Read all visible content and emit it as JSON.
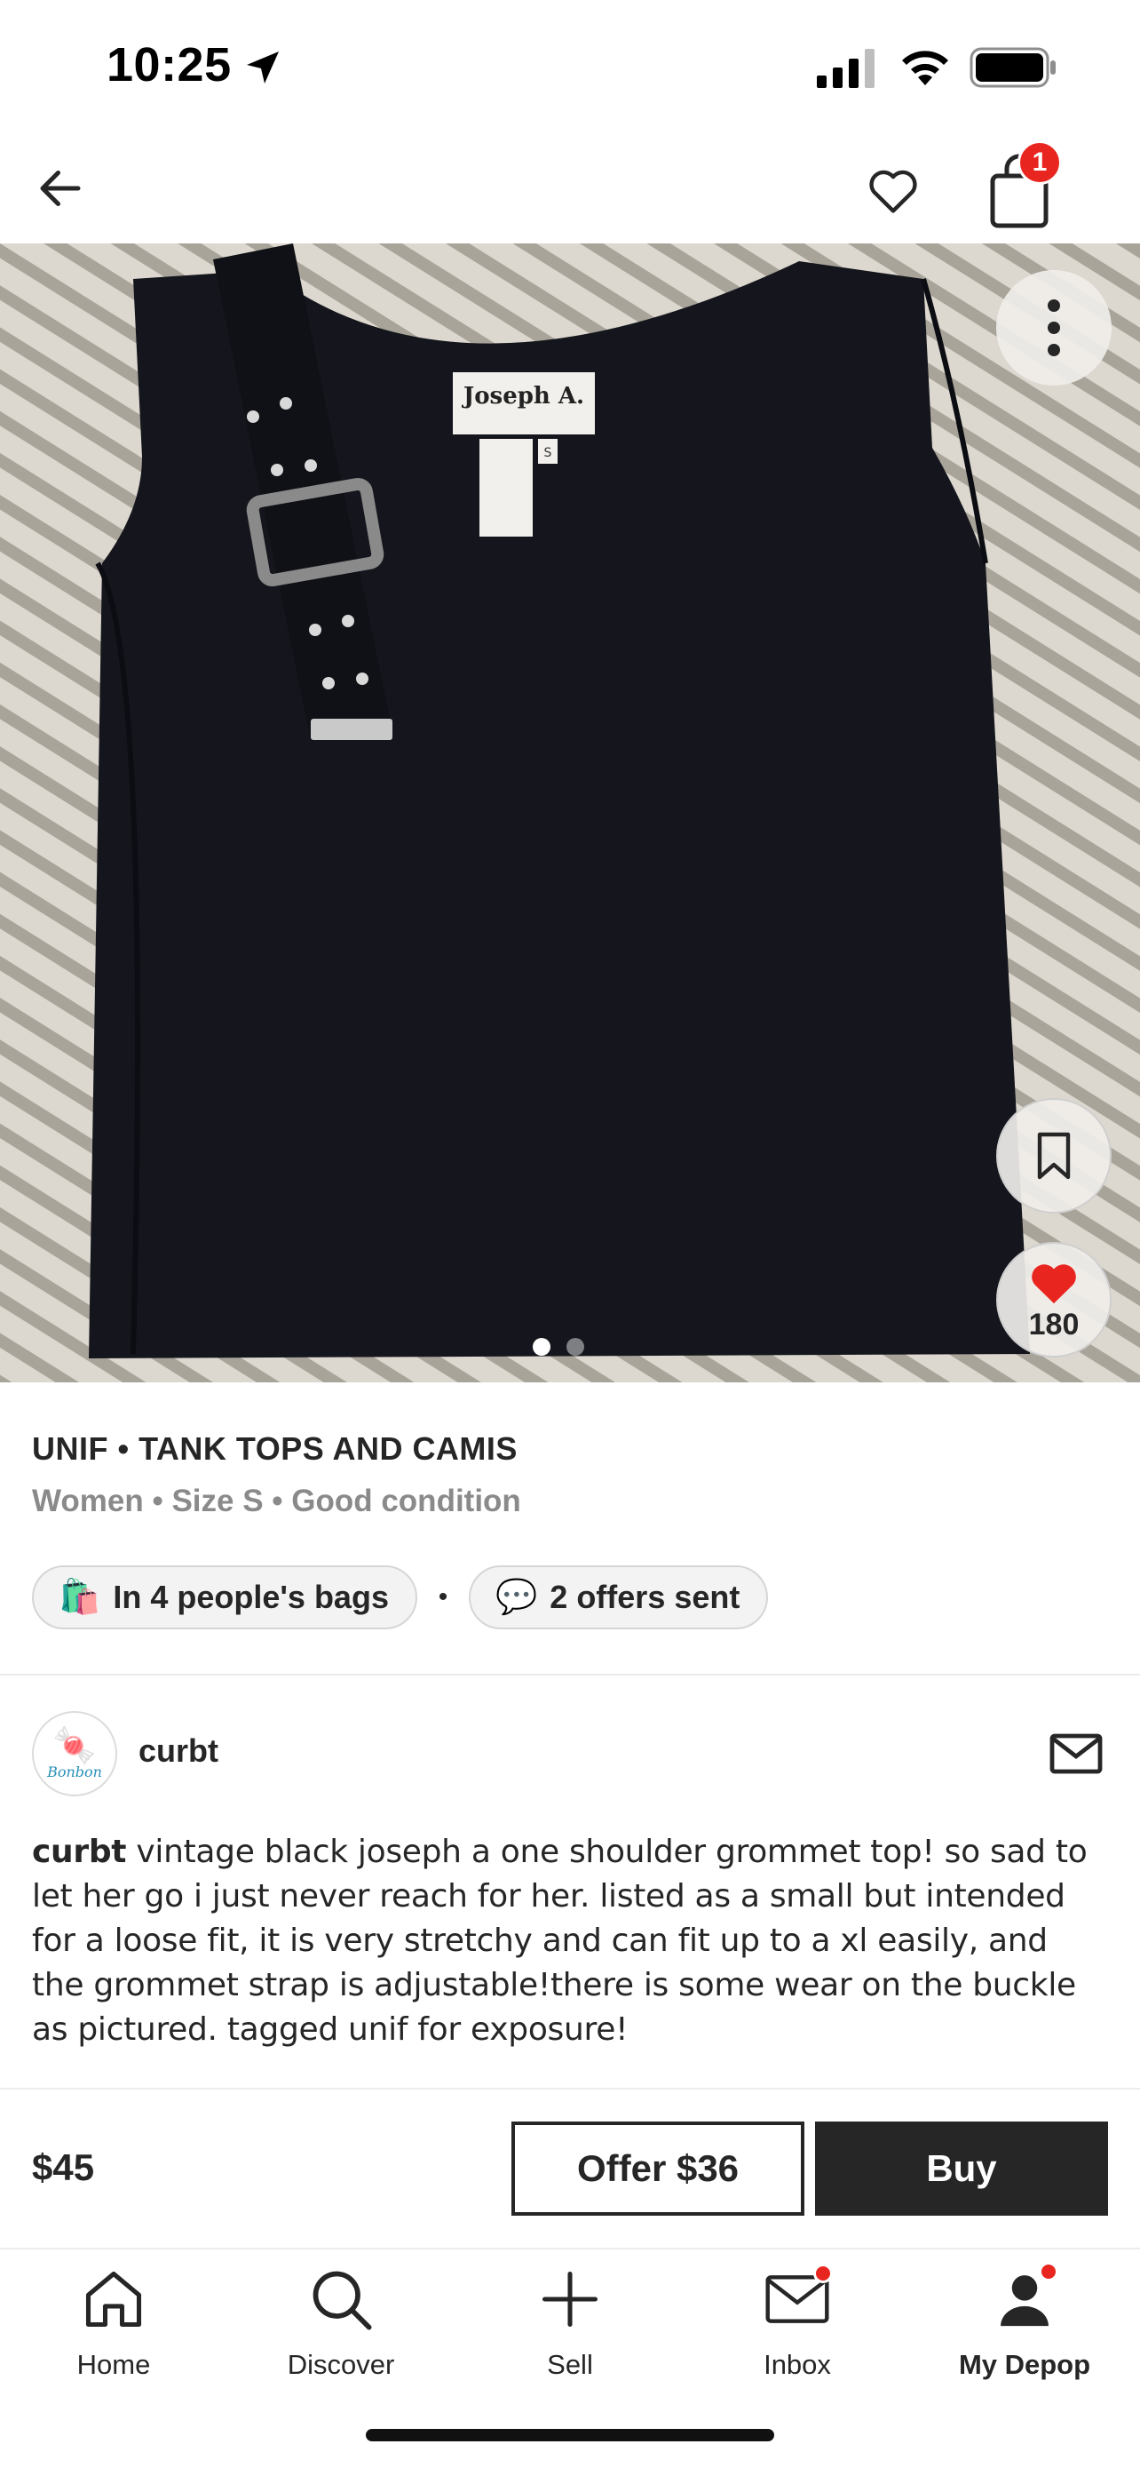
{
  "status_bar": {
    "time": "10:25"
  },
  "nav": {
    "bag_count": "1"
  },
  "image": {
    "like_count": "180",
    "total_slides": 2,
    "current_slide": 1
  },
  "product": {
    "title": "UNIF • TANK TOPS AND CAMIS",
    "subtitle": "Women • Size S • Good condition",
    "bags_chip": "In 4 people's bags",
    "bags_icon": "🛍️",
    "chip_separator": "•",
    "offers_chip": "2 offers sent",
    "offers_icon": "💬"
  },
  "seller": {
    "name": "curbt",
    "avatar_text": "Bonbon",
    "avatar_icon": "🍬"
  },
  "description": {
    "user": "curbt",
    "text": "vintage black joseph a one shoulder grommet top! so sad to let her go i just never reach for her. listed as a small but intended for a loose fit, it is very stretchy and can fit up to a xl easily, and the grommet strap is adjustable!there is some wear on the buckle as pictured. tagged unif for exposure!"
  },
  "buy_bar": {
    "price": "$45",
    "offer_label": "Offer $36",
    "buy_label": "Buy"
  },
  "tabs": [
    {
      "label": "Home",
      "icon": "home-icon"
    },
    {
      "label": "Discover",
      "icon": "search-icon"
    },
    {
      "label": "Sell",
      "icon": "plus-icon"
    },
    {
      "label": "Inbox",
      "icon": "mail-icon"
    },
    {
      "label": "My Depop",
      "icon": "profile-icon"
    }
  ],
  "colors": {
    "accent_red": "#e8251e",
    "text_dark": "#262626",
    "text_muted": "#8a8a8a"
  },
  "image_text": {
    "tag_brand": "Joseph A.",
    "tag_size": "S"
  }
}
